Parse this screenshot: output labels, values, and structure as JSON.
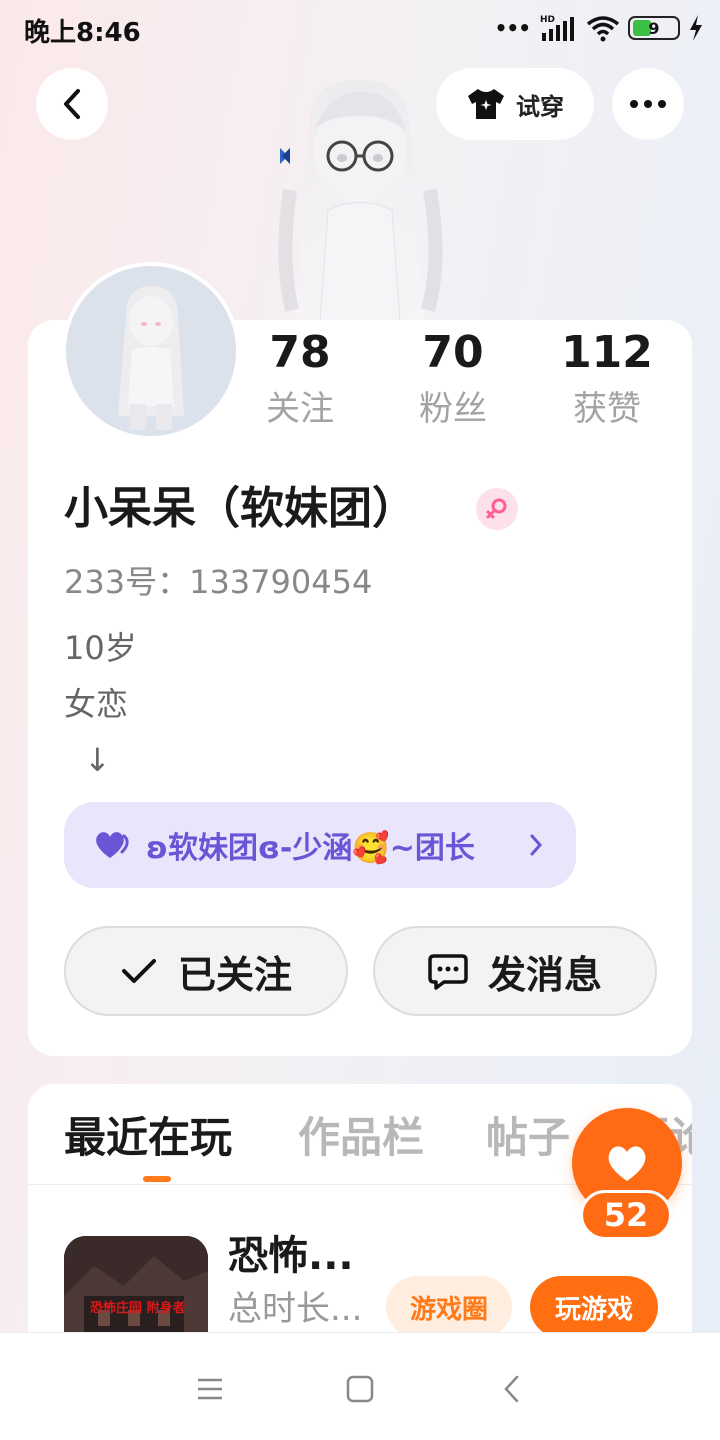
{
  "status_bar": {
    "time": "晚上8:46",
    "battery": "9",
    "signal_label": "HD"
  },
  "top_nav": {
    "try_on_label": "试穿"
  },
  "stats": [
    {
      "value": "78",
      "label": "关注"
    },
    {
      "value": "70",
      "label": "粉丝"
    },
    {
      "value": "112",
      "label": "获赞"
    }
  ],
  "profile": {
    "nickname": "小呆呆（软妹团）",
    "uid": "233号：133790454",
    "bio": [
      "10岁",
      "女恋",
      "↓"
    ]
  },
  "group": {
    "label": "ʚ软妹团ɞ-少涵🥰~团长"
  },
  "actions": {
    "follow_label": "已关注",
    "message_label": "发消息"
  },
  "tabs": [
    "最近在玩",
    "作品栏",
    "帖子",
    "评论"
  ],
  "game": {
    "title": "恐怖...",
    "subtitle": "总时长...",
    "circle_label": "游戏圈",
    "play_label": "玩游戏",
    "thumb_text": "恐怖庄园 附身者"
  },
  "like": {
    "count": "52"
  },
  "colors": {
    "accent": "#ff6a14",
    "group_bg": "#e9e5fb",
    "group_text": "#6b55d6"
  }
}
